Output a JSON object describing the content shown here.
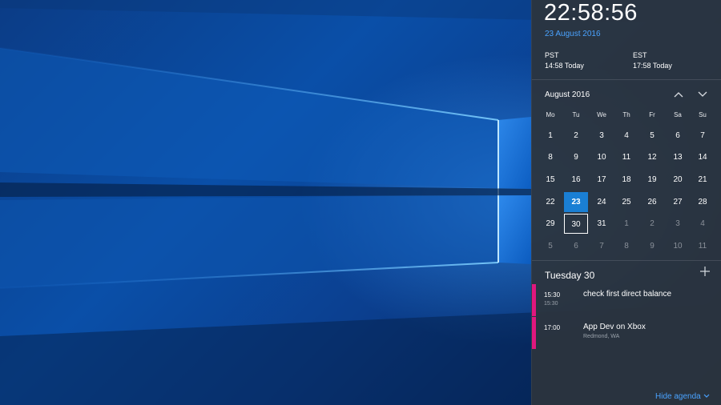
{
  "clock": {
    "time": "22:58:56",
    "date": "23 August 2016"
  },
  "timezones": [
    {
      "name": "PST",
      "value": "14:58 Today"
    },
    {
      "name": "EST",
      "value": "17:58 Today"
    }
  ],
  "calendar": {
    "month_label": "August 2016",
    "prev_icon": "chevron-up-icon",
    "next_icon": "chevron-down-icon",
    "weekdays": [
      "Mo",
      "Tu",
      "We",
      "Th",
      "Fr",
      "Sa",
      "Su"
    ],
    "weeks": [
      [
        "1",
        "2",
        "3",
        "4",
        "5",
        "6",
        "7"
      ],
      [
        "8",
        "9",
        "10",
        "11",
        "12",
        "13",
        "14"
      ],
      [
        "15",
        "16",
        "17",
        "18",
        "19",
        "20",
        "21"
      ],
      [
        "22",
        "23",
        "24",
        "25",
        "26",
        "27",
        "28"
      ],
      [
        "29",
        "30",
        "31",
        "1",
        "2",
        "3",
        "4"
      ],
      [
        "5",
        "6",
        "7",
        "8",
        "9",
        "10",
        "11"
      ]
    ],
    "today": "23",
    "selected": "30"
  },
  "agenda": {
    "title": "Tuesday 30",
    "add_icon": "plus-icon",
    "events": [
      {
        "start": "15:30",
        "end": "15:30",
        "title": "check first direct balance",
        "subtitle": ""
      },
      {
        "start": "17:00",
        "end": "",
        "title": "App Dev on Xbox",
        "subtitle": "Redmond, WA"
      }
    ],
    "accent": "#e0177e"
  },
  "footer": {
    "hide_label": "Hide agenda",
    "hide_icon": "chevron-down-icon"
  },
  "colors": {
    "accent": "#4aa3ff",
    "today_fill": "#1a7fd4",
    "panel": "#2c343e"
  }
}
